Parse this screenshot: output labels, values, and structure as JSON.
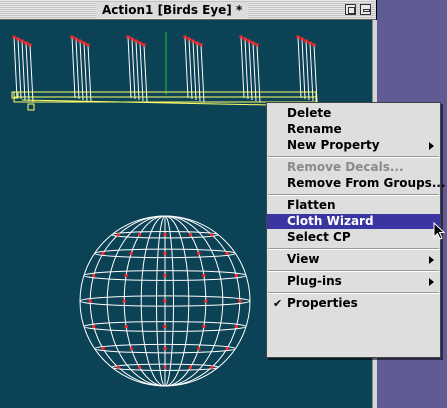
{
  "window": {
    "title": "Action1 [Birds Eye] *"
  },
  "context_menu": {
    "items": [
      {
        "label": "Delete",
        "enabled": true
      },
      {
        "label": "Rename",
        "enabled": true
      },
      {
        "label": "New Property",
        "enabled": true,
        "submenu": true
      },
      {
        "label": "Remove Decals...",
        "enabled": false
      },
      {
        "label": "Remove From Groups...",
        "enabled": true
      },
      {
        "label": "Flatten",
        "enabled": true
      },
      {
        "label": "Cloth Wizard",
        "enabled": true,
        "highlighted": true
      },
      {
        "label": "Select CP",
        "enabled": true
      },
      {
        "label": "View",
        "enabled": true,
        "submenu": true
      },
      {
        "label": "Plug-ins",
        "enabled": true,
        "submenu": true
      },
      {
        "label": "Properties",
        "enabled": true,
        "checked": true
      }
    ]
  },
  "colors": {
    "viewport_bg": "#0c4256",
    "wireframe": "#ffffff",
    "control_points": "#ff2a2a",
    "selection": "#ffff66",
    "axis": "#1fbf2f",
    "menu_highlight": "#3a35a0",
    "desktop": "#5f5c95"
  }
}
